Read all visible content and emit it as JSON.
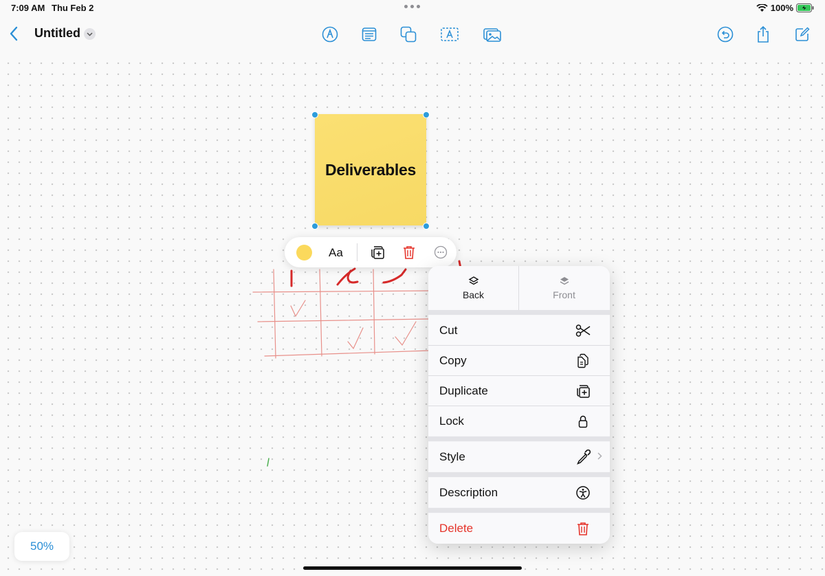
{
  "status_bar": {
    "time": "7:09 AM",
    "date": "Thu Feb 2",
    "battery": "100%"
  },
  "header": {
    "title": "Untitled",
    "tools": [
      "pen-tool-icon",
      "note-icon",
      "shapes-icon",
      "text-box-icon",
      "media-icon"
    ],
    "right": [
      "undo-icon",
      "share-icon",
      "compose-icon"
    ]
  },
  "sticky_note": {
    "text": "Deliverables",
    "color": "#f9dd6a"
  },
  "quick_toolbar": {
    "font_label": "Aa",
    "swatch_color": "#fbd95c"
  },
  "context_menu": {
    "layer": {
      "back": "Back",
      "front": "Front"
    },
    "items": [
      {
        "label": "Cut",
        "icon": "scissors-icon"
      },
      {
        "label": "Copy",
        "icon": "copy-icon"
      },
      {
        "label": "Duplicate",
        "icon": "duplicate-icon"
      },
      {
        "label": "Lock",
        "icon": "lock-icon"
      },
      {
        "label": "Style",
        "icon": "eyedropper-icon"
      },
      {
        "label": "Description",
        "icon": "accessibility-icon"
      },
      {
        "label": "Delete",
        "icon": "trash-icon"
      }
    ],
    "delete_color": "#e5332a"
  },
  "zoom": {
    "level": "50%"
  },
  "accent_color": "#2b8fd6"
}
